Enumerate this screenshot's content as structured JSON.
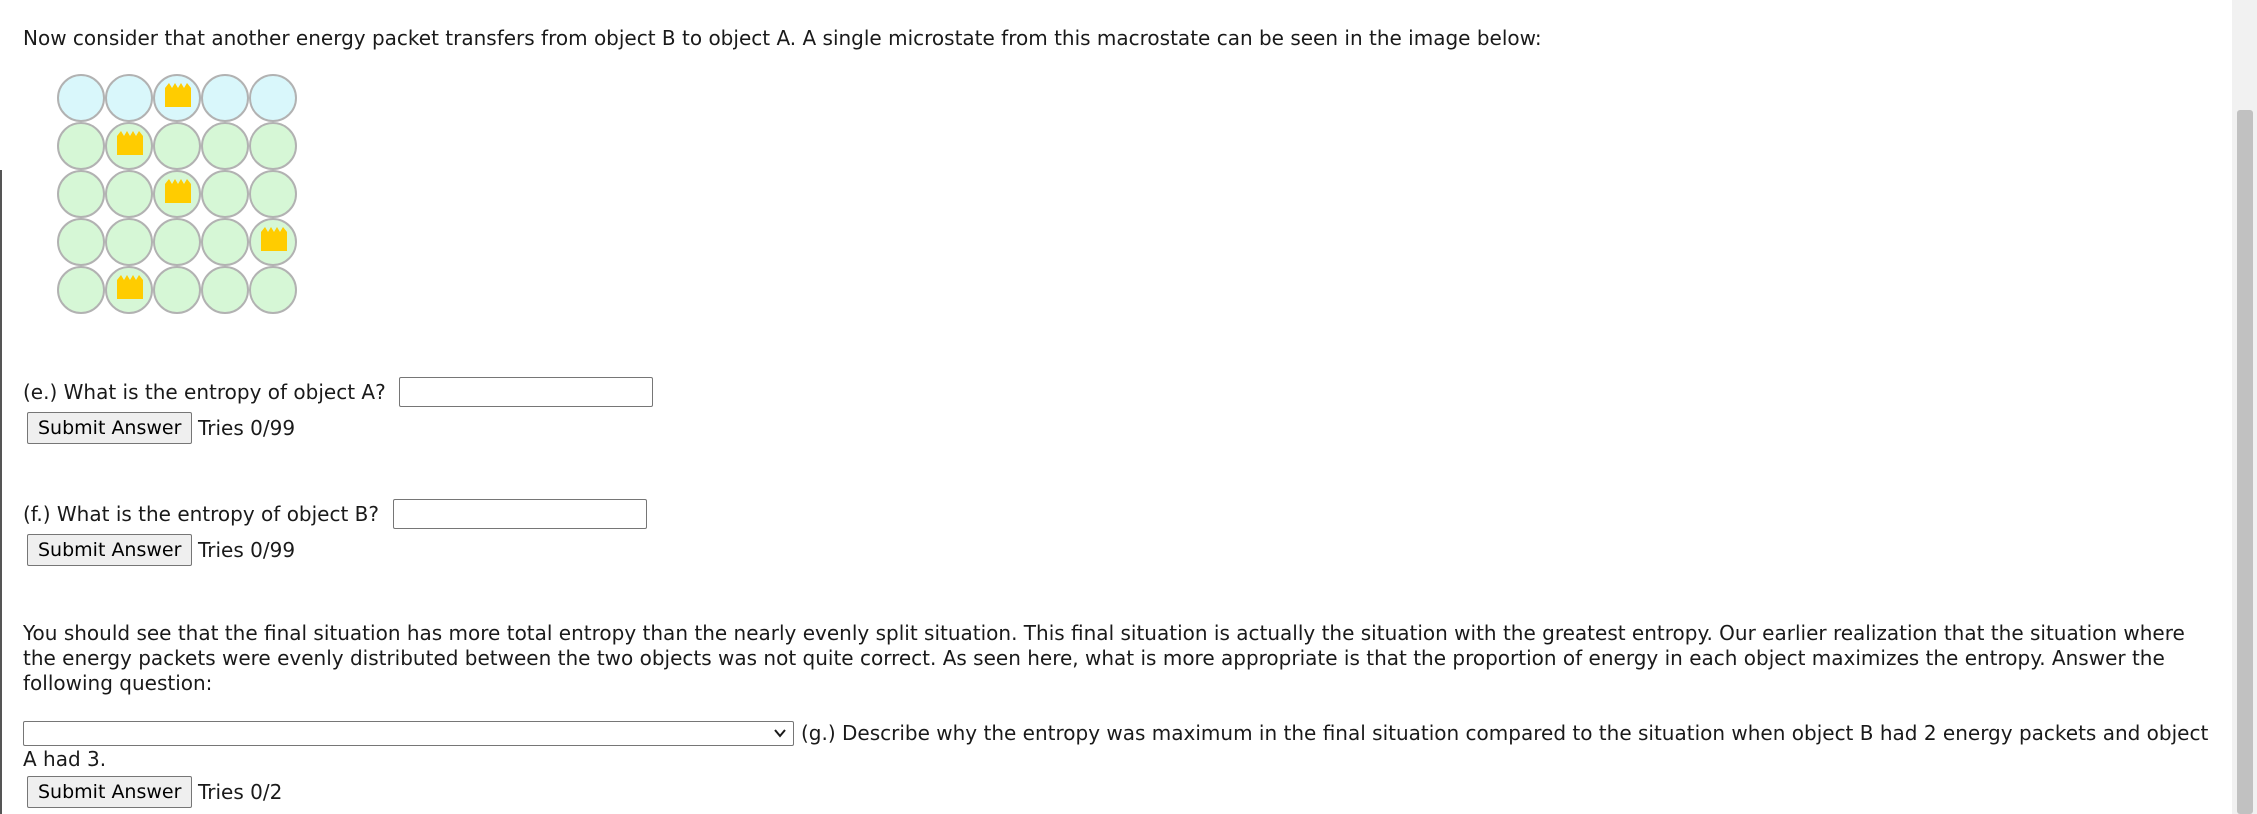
{
  "intro_text": "Now consider that another energy packet transfers from object B to object A. A single microstate from this macrostate can be seen in the image below:",
  "microstate": {
    "colors": {
      "object_b": "#d9f7fb",
      "object_a": "#d6f7d6",
      "packet": "#ffcc00",
      "cell_border": "#b2b2b2"
    },
    "rows": [
      [
        "B",
        "B",
        "B*",
        "B",
        "B"
      ],
      [
        "A",
        "A*",
        "A",
        "A",
        "A"
      ],
      [
        "A",
        "A",
        "A*",
        "A",
        "A"
      ],
      [
        "A",
        "A",
        "A",
        "A",
        "A*"
      ],
      [
        "A",
        "A*",
        "A",
        "A",
        "A"
      ]
    ]
  },
  "question_e": {
    "label": "(e.) What is the entropy of object A?",
    "value": "",
    "submit_label": "Submit Answer",
    "tries": "Tries 0/99"
  },
  "question_f": {
    "label": "(f.) What is the entropy of object B?",
    "value": "",
    "submit_label": "Submit Answer",
    "tries": "Tries 0/99"
  },
  "paragraph": "You should see that the final situation has more total entropy than the nearly evenly split situation. This final situation is actually the situation with the greatest entropy. Our earlier realization that the situation where the energy packets were evenly distributed between the two objects was not quite correct. As seen here, what is more appropriate is that the proportion of energy in each object maximizes the entropy. Answer the following question:",
  "question_g": {
    "selected": "",
    "label": "(g.) Describe why the entropy was maximum in the final situation compared to the situation when object B had 2 energy packets and object A had 3.",
    "submit_label": "Submit Answer",
    "tries": "Tries 0/2"
  },
  "icons": {
    "packet": "energy-packet-icon",
    "dropdown": "chevron-down-icon"
  }
}
